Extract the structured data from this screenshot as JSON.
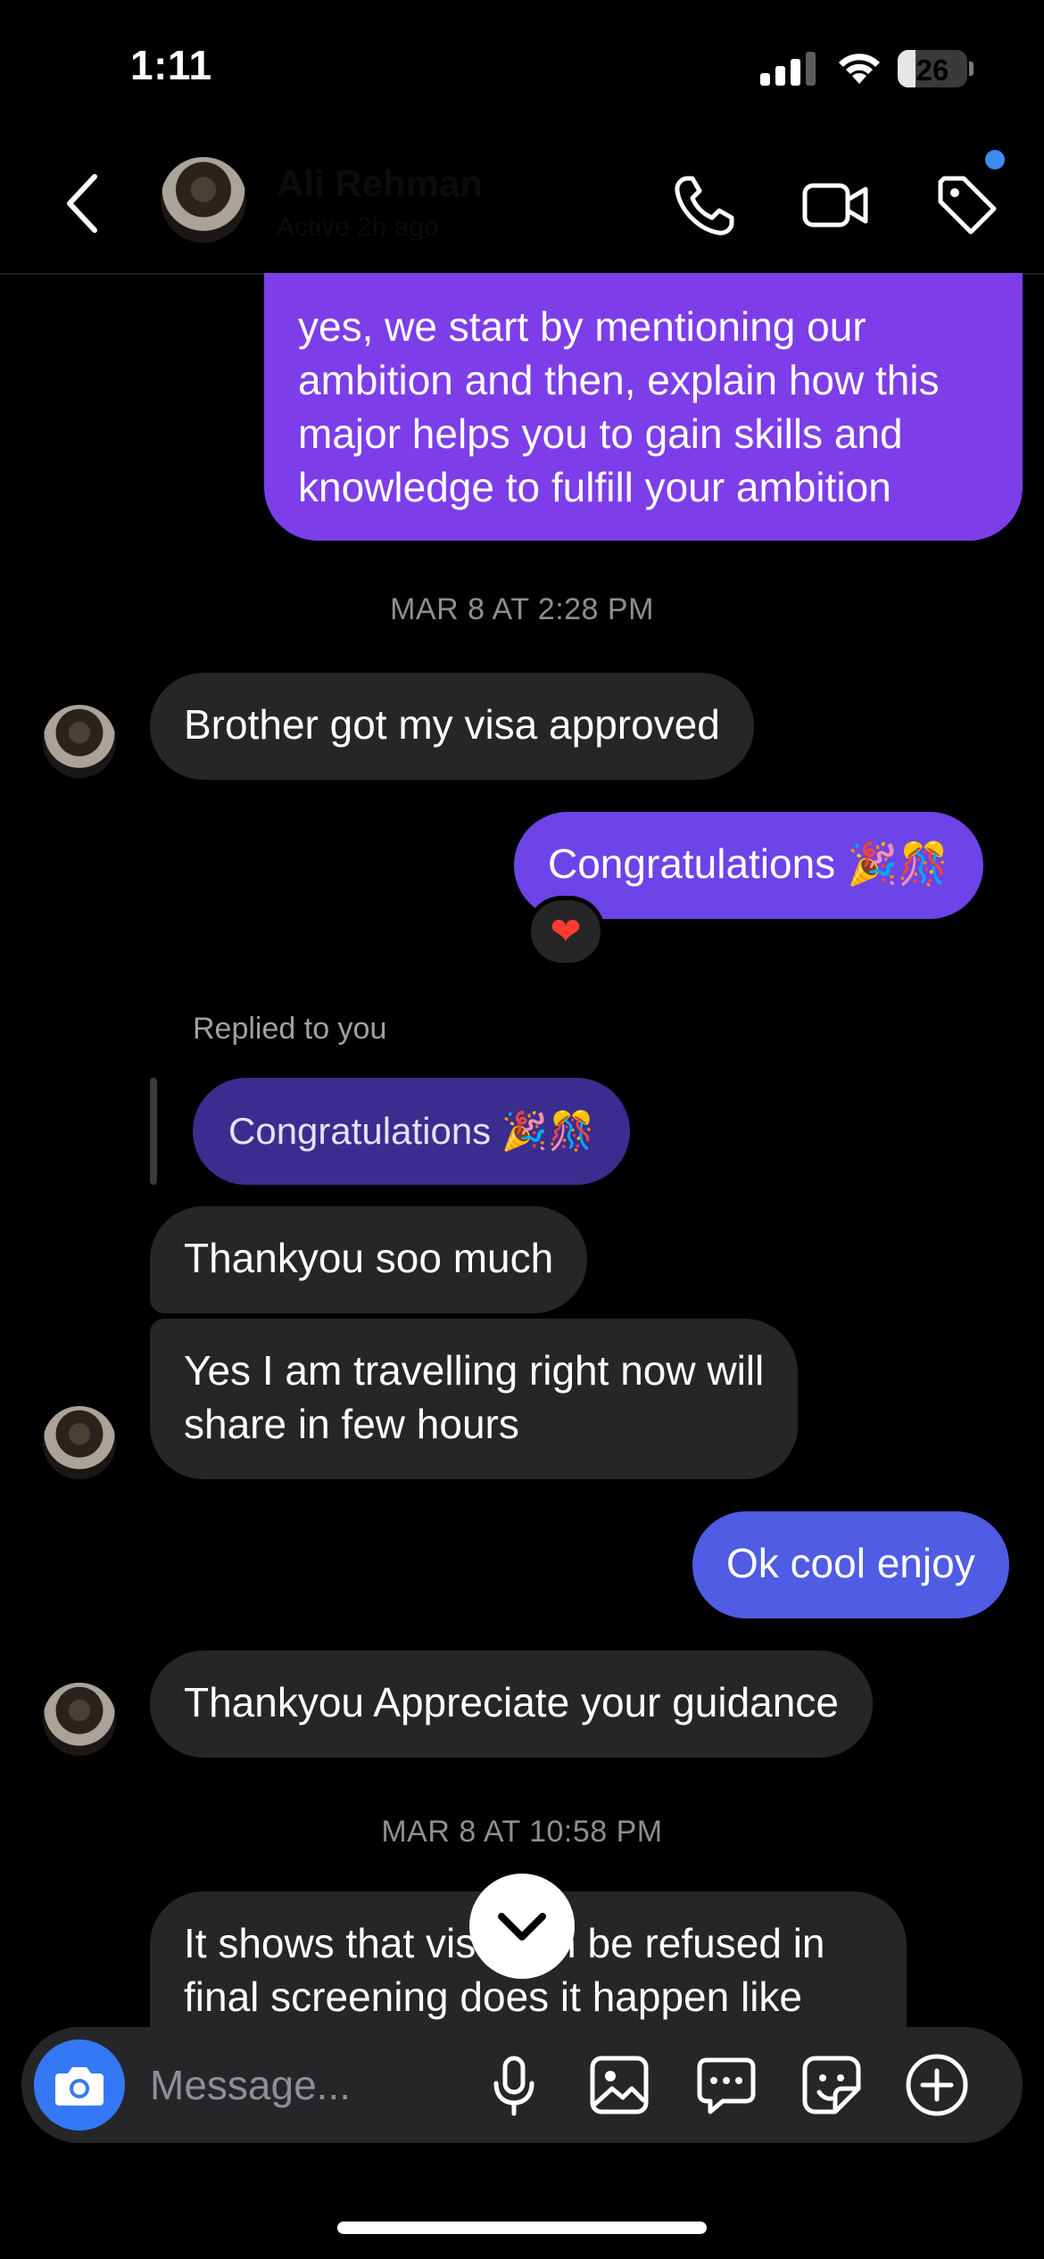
{
  "status": {
    "time": "1:11",
    "battery": "26",
    "battery_level": 0.26
  },
  "header": {
    "contact_name": "Ali Rehman",
    "contact_sub": "Active 2h ago",
    "icons": [
      "back-icon",
      "phone-icon",
      "video-icon",
      "tag-icon"
    ]
  },
  "messages": {
    "m1": "yes, we start by mentioning our\nambition and then, explain how this\nmajor helps you to gain skills and\nknowledge to fulfill your ambition",
    "ts1": "MAR 8 AT 2:28 PM",
    "m2": "Brother got my visa approved",
    "m3": "Congratulations 🎉🎊",
    "reaction": "❤",
    "reply_label": "Replied to you",
    "reply_quote": "Congratulations 🎉🎊",
    "m4": "Thankyou soo much",
    "m5": "Yes I am travelling right now will\nshare in few hours",
    "m6": "Ok cool enjoy",
    "m7": "Thankyou Appreciate your guidance",
    "ts2": "MAR 8 AT 10:58 PM",
    "m8": "It shows that visa can be refused in\nfinal screening does it happen like"
  },
  "composer": {
    "placeholder": "Message...",
    "icons": [
      "camera-icon",
      "microphone-icon",
      "gallery-icon",
      "chat-icon",
      "sticker-icon",
      "plus-icon"
    ]
  },
  "colors": {
    "accent_blue": "#3478f6",
    "bubble_in": "#262628",
    "bubble_purple": "#7d3ee9",
    "bubble_blue": "#4f5ce3"
  }
}
